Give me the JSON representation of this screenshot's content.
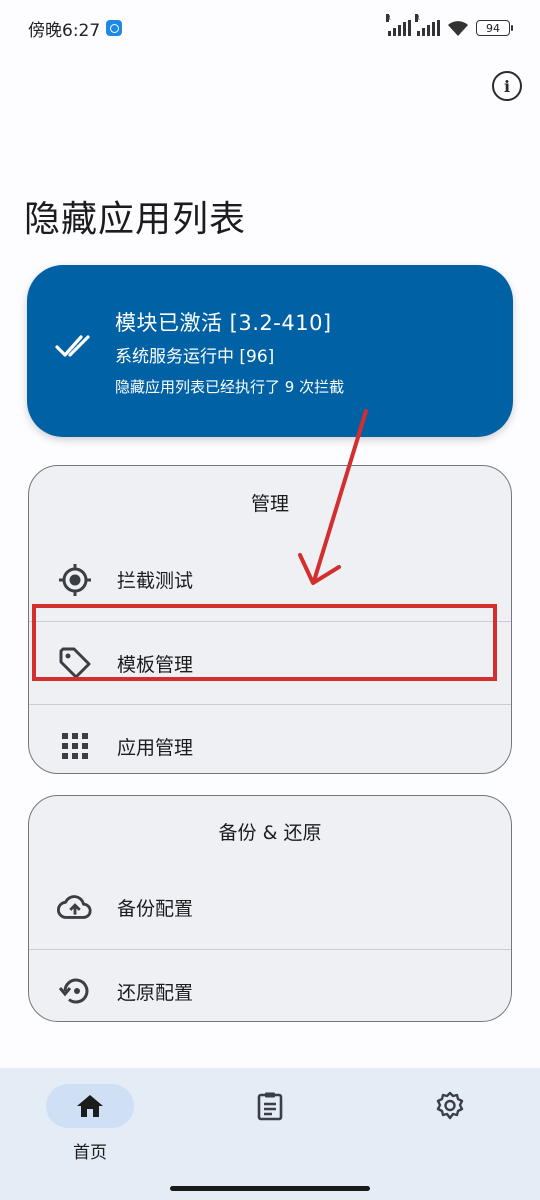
{
  "status_bar": {
    "time": "傍晚6:27",
    "battery": "94",
    "sim1_label": "R",
    "sim2_label": "R"
  },
  "header": {
    "title": "隐藏应用列表",
    "info_icon": "info-icon"
  },
  "status_card": {
    "line1": "模块已激活 [3.2-410]",
    "line2": "系统服务运行中 [96]",
    "line3": "隐藏应用列表已经执行了 9 次拦截",
    "icon": "done-all-icon",
    "color": "#0061a4"
  },
  "manage": {
    "title": "管理",
    "items": [
      {
        "label": "拦截测试",
        "icon": "gps-target-icon"
      },
      {
        "label": "模板管理",
        "icon": "tag-icon"
      },
      {
        "label": "应用管理",
        "icon": "apps-grid-icon"
      }
    ]
  },
  "backup": {
    "title": "备份 & 还原",
    "items": [
      {
        "label": "备份配置",
        "icon": "cloud-upload-icon"
      },
      {
        "label": "还原配置",
        "icon": "restore-icon"
      }
    ]
  },
  "bottom_nav": {
    "home_label": "首页",
    "home_icon": "home-icon",
    "logs_icon": "clipboard-icon",
    "settings_icon": "gear-icon"
  },
  "annotation": {
    "highlight_color": "#d32f2f"
  }
}
